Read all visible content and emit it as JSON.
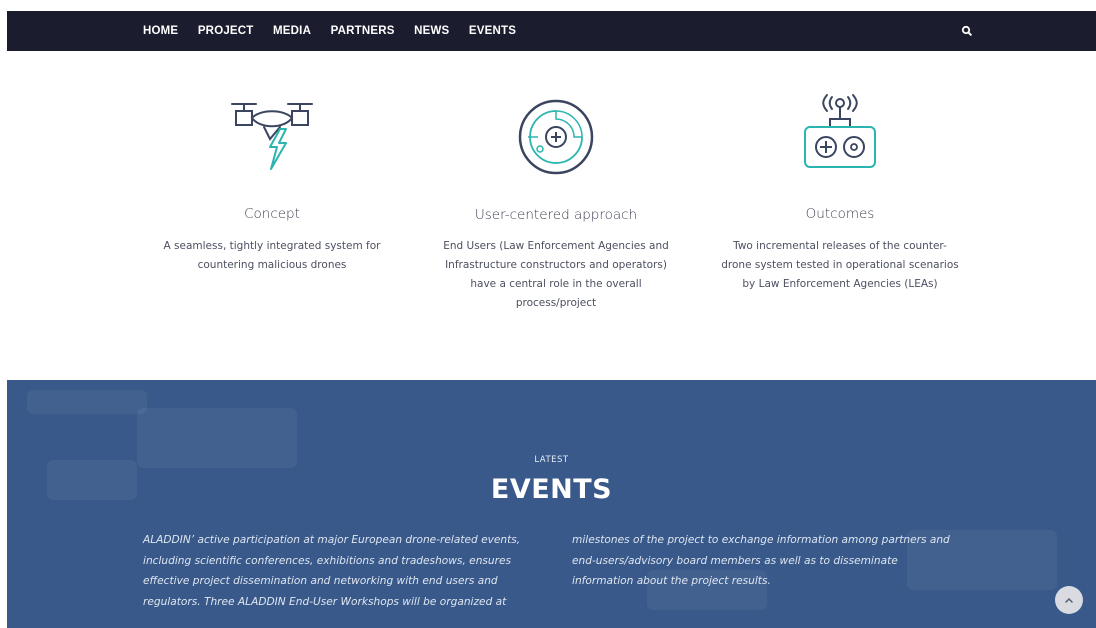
{
  "nav": {
    "items": [
      {
        "label": "HOME"
      },
      {
        "label": "PROJECT"
      },
      {
        "label": "MEDIA"
      },
      {
        "label": "PARTNERS"
      },
      {
        "label": "NEWS"
      },
      {
        "label": "EVENTS"
      }
    ],
    "search_icon": "search-icon"
  },
  "features": [
    {
      "icon": "drone-lightning-icon",
      "title": "Concept",
      "description_lines": [
        "A seamless, tightly integrated system for",
        "countering malicious drones"
      ]
    },
    {
      "icon": "radar-icon",
      "title": "User-centered approach",
      "description_lines": [
        "End Users (Law Enforcement Agencies and",
        "Infrastructure constructors and operators)",
        "have a central role in the overall",
        "process/project"
      ]
    },
    {
      "icon": "remote-controller-icon",
      "title": "Outcomes",
      "description_lines": [
        "Two incremental releases of the counter-",
        "drone system tested in operational scenarios",
        "by Law Enforcement Agencies (LEAs)"
      ]
    }
  ],
  "events": {
    "latest_label": "LATEST",
    "title": "EVENTS",
    "col_left_lines": [
      "ALADDIN’ active participation at major European drone-related events,",
      "including scientific conferences, exhibitions and tradeshows, ensures",
      "effective project dissemination and networking with end users and",
      "regulators. Three ALADDIN End-User Workshops will be organized at"
    ],
    "col_right_lines": [
      "milestones of the project to exchange information among partners and",
      "end-users/advisory board members as well as to disseminate",
      "information about the project results."
    ],
    "scroll_top_icon": "chevron-up-icon"
  },
  "colors": {
    "navbar": "#1b1d2e",
    "events_bg": "#38598a",
    "icon_dark": "#3b4560",
    "icon_teal": "#2ab5b0"
  }
}
